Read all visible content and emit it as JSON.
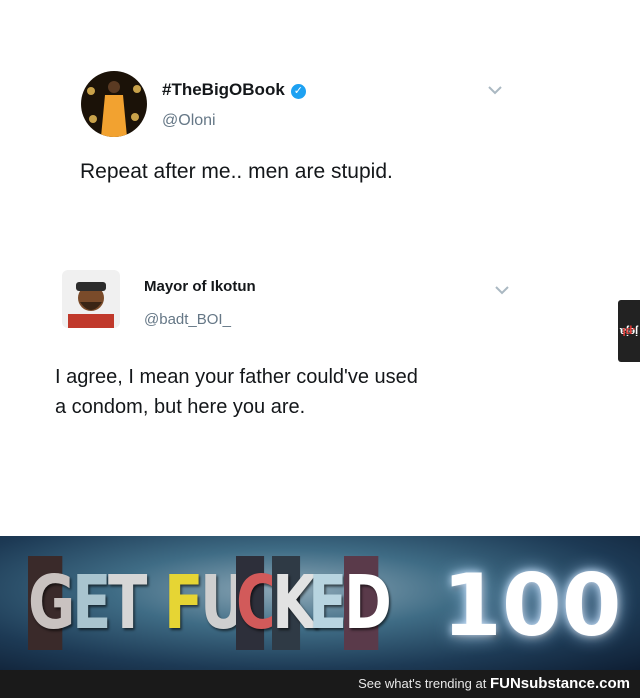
{
  "tweet1": {
    "display_name": "#TheBigOBook",
    "handle": "@Oloni",
    "text": "Repeat after me.. men are stupid."
  },
  "tweet2": {
    "display_name": "Mayor of Ikotun",
    "handle": "@badt_BOI_",
    "text_line1": "I agree, I mean your father could've used",
    "text_line2": "a condom, but here you are."
  },
  "side_watermark": {
    "main": "jeja",
    "suffix": ".pl"
  },
  "banner": {
    "letters": [
      "G",
      "E",
      "T",
      " ",
      "F",
      "U",
      "C",
      "K",
      "E",
      "D"
    ],
    "score": "100"
  },
  "footer": {
    "prefix": "See what's trending at ",
    "brand_bold": "FUN",
    "brand_rest": "substance.com"
  },
  "colors": {
    "verified": "#1da1f2",
    "handle": "#657786",
    "footer_bg": "#1a1a1a"
  }
}
